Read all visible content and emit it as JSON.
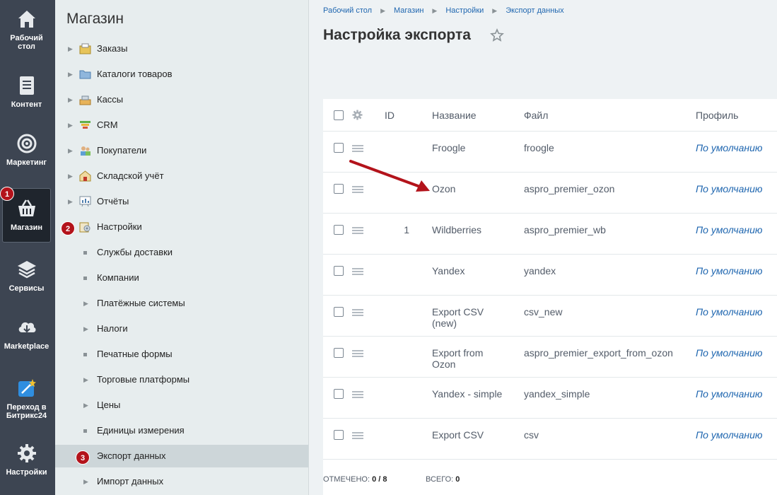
{
  "iconbar": {
    "items": [
      {
        "label": "Рабочий стол",
        "icon": "home-icon"
      },
      {
        "label": "Контент",
        "icon": "document-icon"
      },
      {
        "label": "Маркетинг",
        "icon": "target-icon"
      },
      {
        "label": "Магазин",
        "icon": "basket-icon"
      },
      {
        "label": "Сервисы",
        "icon": "layers-icon"
      },
      {
        "label": "Marketplace",
        "icon": "cloud-download-icon"
      },
      {
        "label": "Переход в Битрикс24",
        "icon": "magic-wand-icon"
      },
      {
        "label": "Настройки",
        "icon": "gear-icon"
      }
    ]
  },
  "badges": [
    "1",
    "2",
    "3"
  ],
  "menu": {
    "title": "Магазин",
    "items": [
      {
        "label": "Заказы"
      },
      {
        "label": "Каталоги товаров"
      },
      {
        "label": "Кассы"
      },
      {
        "label": "CRM"
      },
      {
        "label": "Покупатели"
      },
      {
        "label": "Складской учёт"
      },
      {
        "label": "Отчёты"
      },
      {
        "label": "Настройки"
      }
    ],
    "subitems": [
      {
        "label": "Службы доставки"
      },
      {
        "label": "Компании"
      },
      {
        "label": "Платёжные системы"
      },
      {
        "label": "Налоги"
      },
      {
        "label": "Печатные формы"
      },
      {
        "label": "Торговые платформы"
      },
      {
        "label": "Цены"
      },
      {
        "label": "Единицы измерения"
      },
      {
        "label": "Экспорт данных"
      },
      {
        "label": "Импорт данных"
      }
    ]
  },
  "breadcrumbs": [
    "Рабочий стол",
    "Магазин",
    "Настройки",
    "Экспорт данных"
  ],
  "page_title": "Настройка экспорта",
  "grid": {
    "columns": {
      "id": "ID",
      "name": "Название",
      "file": "Файл",
      "profile": "Профиль"
    },
    "rows": [
      {
        "id": "",
        "name": "Froogle",
        "file": "froogle",
        "profile": "По умолчанию"
      },
      {
        "id": "",
        "name": "Ozon",
        "file": "aspro_premier_ozon",
        "profile": "По умолчанию"
      },
      {
        "id": "1",
        "name": "Wildberries",
        "file": "aspro_premier_wb",
        "profile": "По умолчанию"
      },
      {
        "id": "",
        "name": "Yandex",
        "file": "yandex",
        "profile": "По умолчанию"
      },
      {
        "id": "",
        "name": "Export CSV (new)",
        "file": "csv_new",
        "profile": "По умолчанию"
      },
      {
        "id": "",
        "name": "Export from Ozon",
        "file": "aspro_premier_export_from_ozon",
        "profile": "По умолчанию"
      },
      {
        "id": "",
        "name": "Yandex - simple",
        "file": "yandex_simple",
        "profile": "По умолчанию"
      },
      {
        "id": "",
        "name": "Export CSV",
        "file": "csv",
        "profile": "По умолчанию"
      }
    ],
    "footer": {
      "marked_label": "ОТМЕЧЕНО:",
      "marked_value": "0 / 8",
      "total_label": "ВСЕГО:",
      "total_value": "0"
    }
  },
  "colors": {
    "accent": "#2067b0",
    "badge": "#b3131b",
    "iconbar": "#3d4552",
    "annotation_arrow": "#b3131b"
  }
}
